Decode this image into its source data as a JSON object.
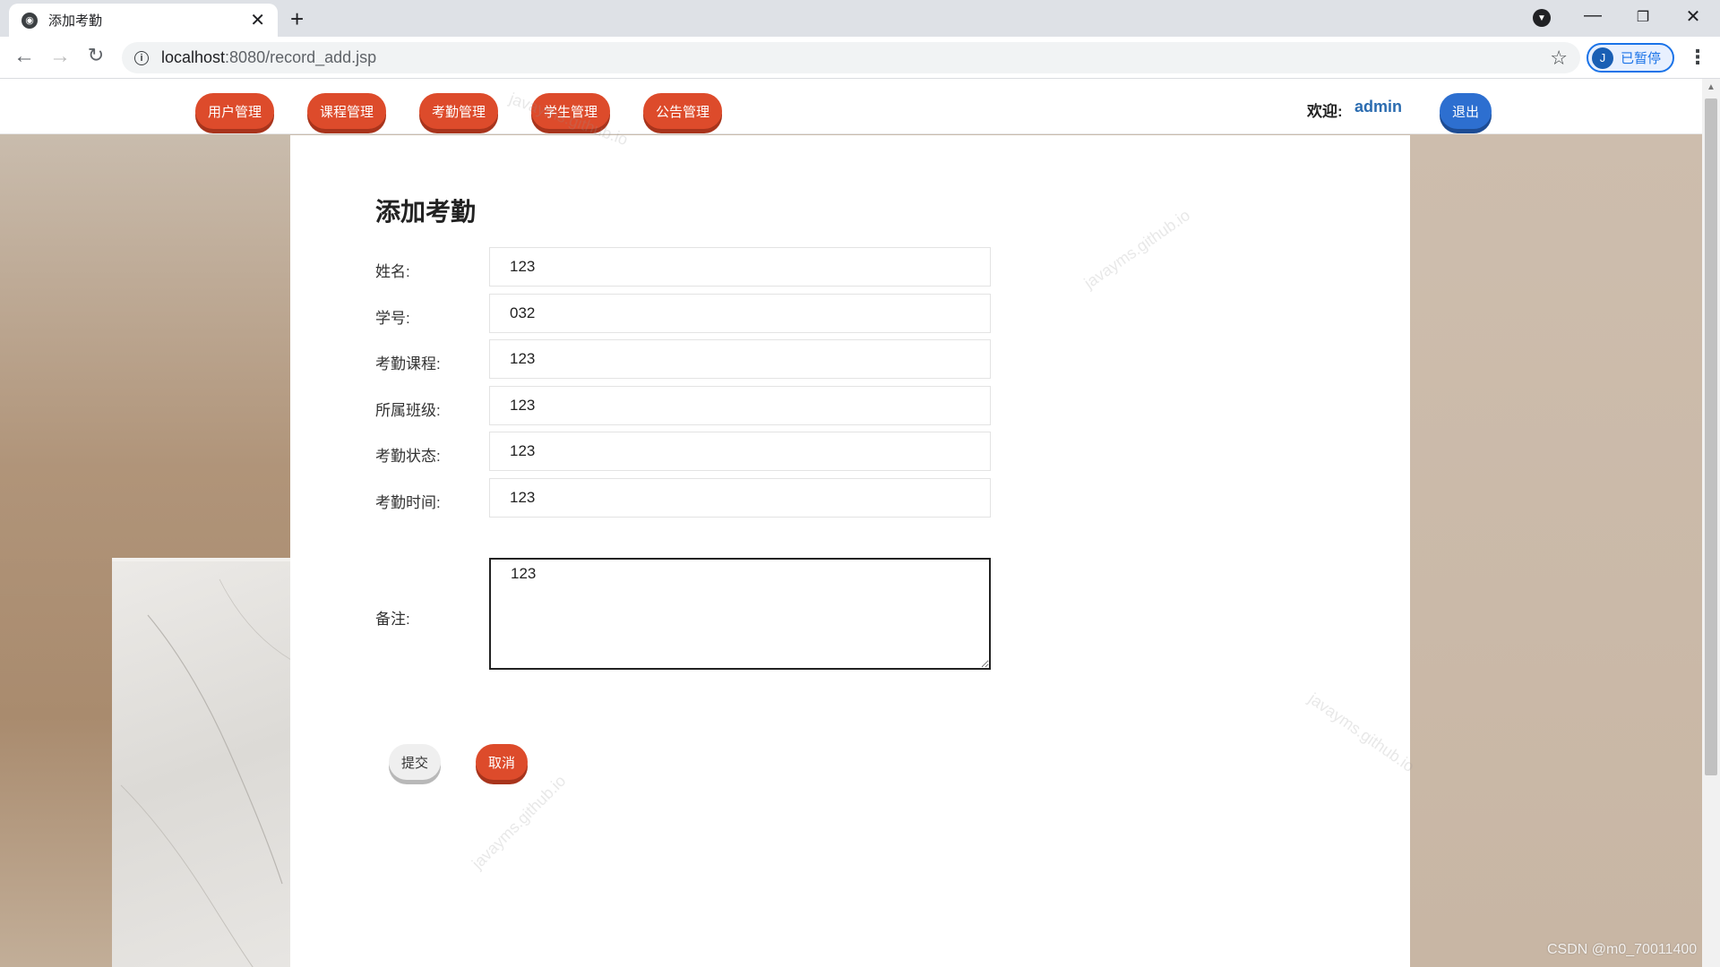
{
  "browser": {
    "tab_title": "添加考勤",
    "new_tab_label": "+",
    "url_host": "localhost",
    "url_path": ":8080/record_add.jsp",
    "profile_initial": "J",
    "profile_status": "已暂停"
  },
  "nav": {
    "items": [
      {
        "label": "用户管理"
      },
      {
        "label": "课程管理"
      },
      {
        "label": "考勤管理"
      },
      {
        "label": "学生管理"
      },
      {
        "label": "公告管理"
      }
    ],
    "welcome_label": "欢迎:",
    "username": "admin",
    "logout_label": "退出"
  },
  "form": {
    "title": "添加考勤",
    "fields": [
      {
        "label": "姓名:",
        "value": "123"
      },
      {
        "label": "学号:",
        "value": "032"
      },
      {
        "label": "考勤课程:",
        "value": "123"
      },
      {
        "label": "所属班级:",
        "value": "123"
      },
      {
        "label": "考勤状态:",
        "value": "123"
      },
      {
        "label": "考勤时间:",
        "value": "123"
      }
    ],
    "remark_label": "备注:",
    "remark_value": "123",
    "submit_label": "提交",
    "cancel_label": "取消"
  },
  "watermark_text": "javayms.github.io",
  "credit_text": "CSDN @m0_70011400"
}
